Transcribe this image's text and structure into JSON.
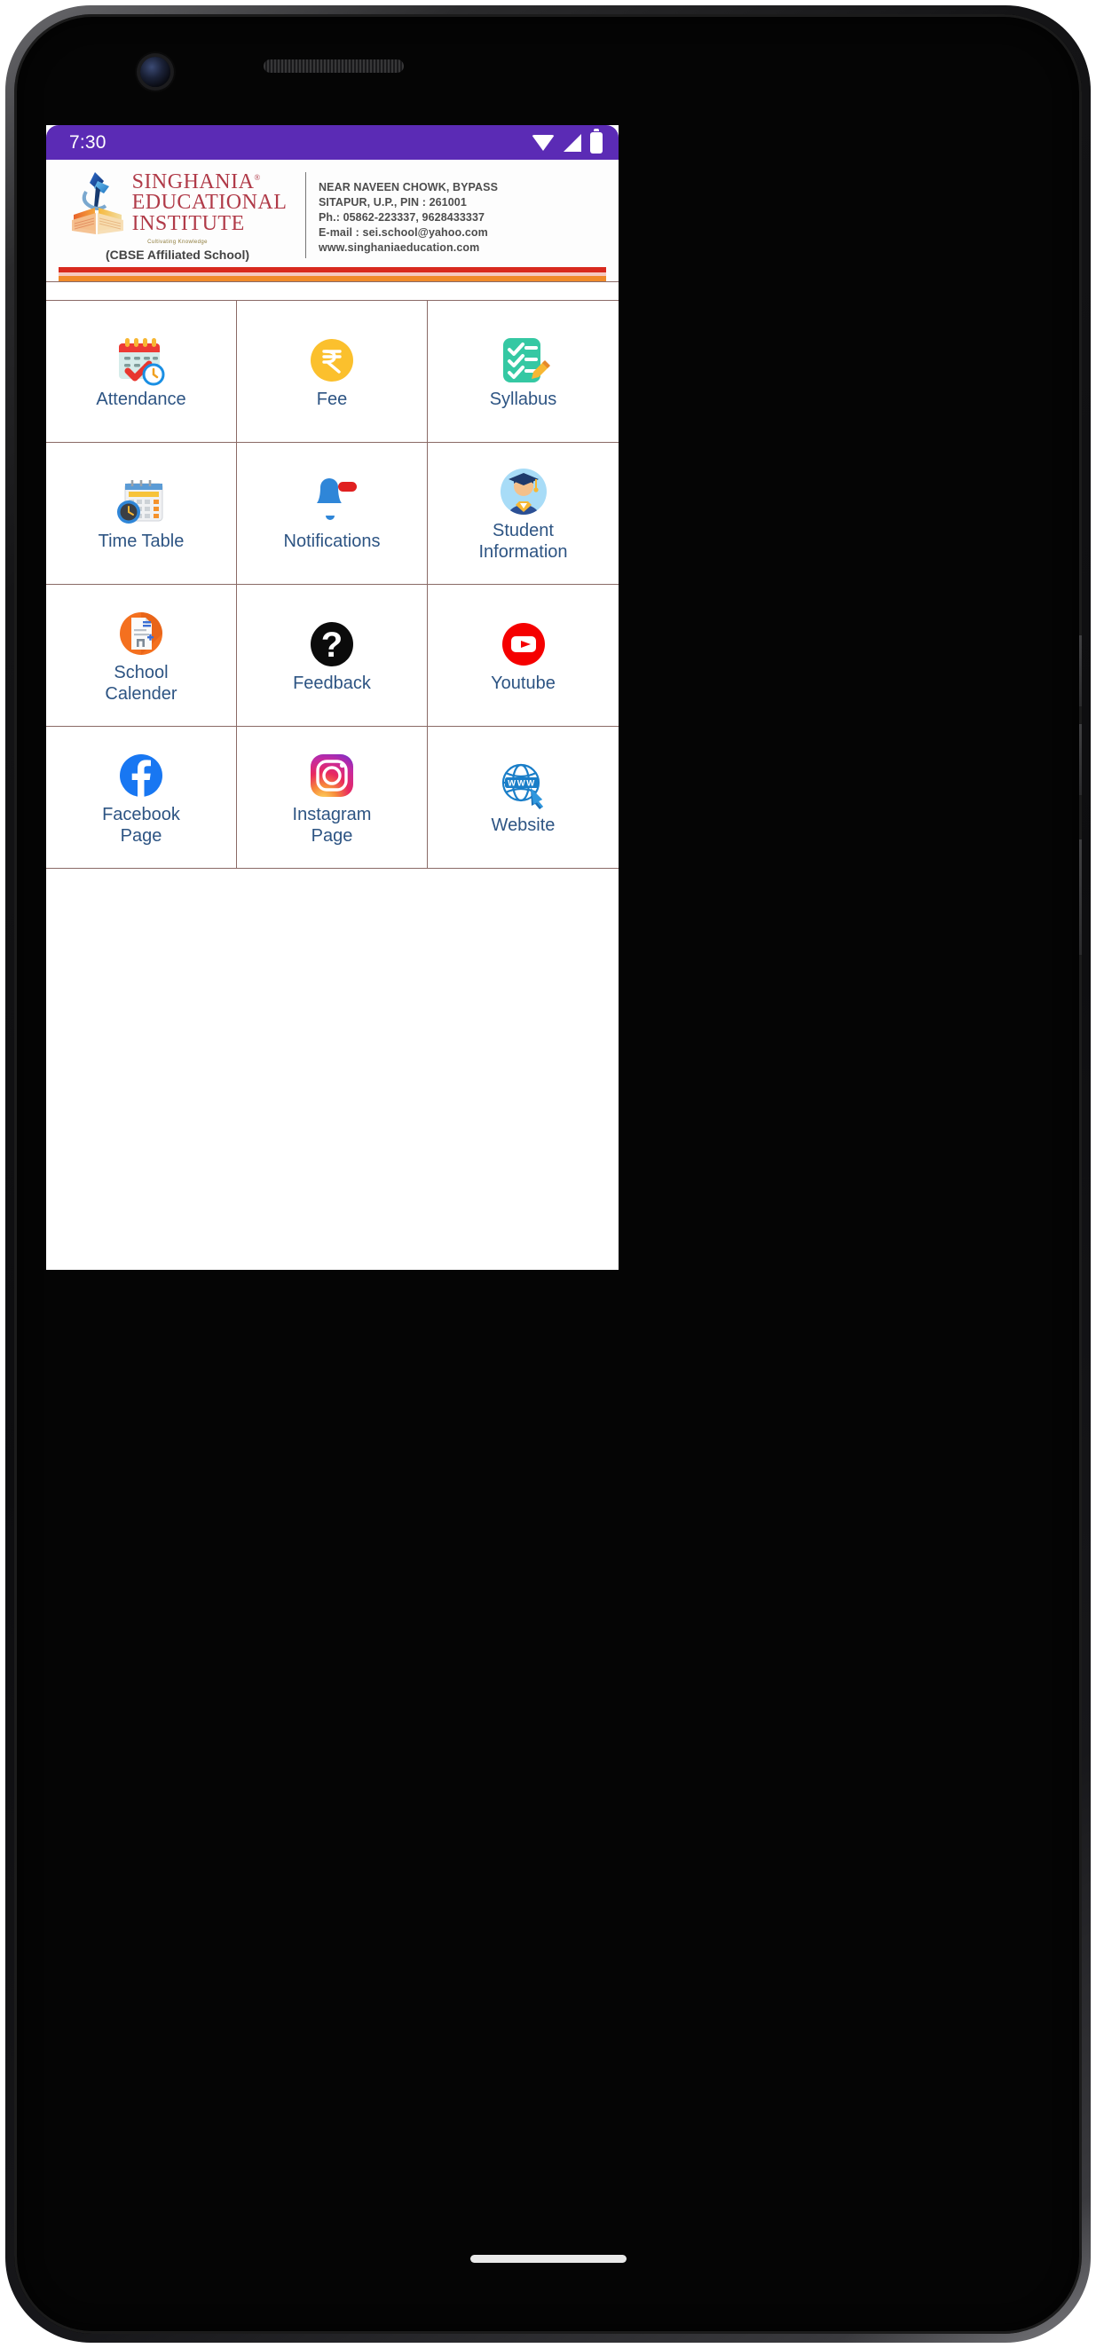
{
  "status_bar": {
    "clock": "7:30",
    "icons": [
      "wifi-icon",
      "cellular-signal-icon",
      "battery-icon"
    ],
    "background_color": "#5B2BB5"
  },
  "letterhead": {
    "logo_icon": "singhania-book-torch-logo",
    "name_line1": "SINGHANIA",
    "name_line1_sup": "®",
    "name_line2": "EDUCATIONAL",
    "name_line3": "INSTITUTE",
    "tagline": "Cultivating Knowledge",
    "affiliation": "(CBSE Affiliated School)",
    "brand_color": "#B03A48",
    "address": [
      "NEAR NAVEEN CHOWK, BYPASS",
      "SITAPUR, U.P., PIN : 261001",
      "Ph.: 05862-223337, 9628433337",
      "E-mail : sei.school@yahoo.com",
      "www.singhaniaeducation.com"
    ],
    "rule_colors": [
      "#D82A1E",
      "#F6C9C0",
      "#F08A2A"
    ]
  },
  "grid": {
    "label_color": "#2D5483",
    "border_color": "#8A6A66",
    "items": [
      {
        "id": "attendance",
        "label": "Attendance",
        "icon": "calendar-check-clock-icon"
      },
      {
        "id": "fee",
        "label": "Fee",
        "icon": "rupee-coin-icon"
      },
      {
        "id": "syllabus",
        "label": "Syllabus",
        "icon": "checklist-pencil-icon"
      },
      {
        "id": "time-table",
        "label": "Time Table",
        "icon": "calendar-clock-icon"
      },
      {
        "id": "notifications",
        "label": "Notifications",
        "icon": "bell-badge-icon"
      },
      {
        "id": "student-information",
        "label": "Student\nInformation",
        "icon": "graduate-avatar-icon"
      },
      {
        "id": "school-calender",
        "label": "School\nCalender",
        "icon": "orange-document-icon"
      },
      {
        "id": "feedback",
        "label": "Feedback",
        "icon": "question-mark-icon"
      },
      {
        "id": "youtube",
        "label": "Youtube",
        "icon": "youtube-icon"
      },
      {
        "id": "facebook-page",
        "label": "Facebook\nPage",
        "icon": "facebook-icon"
      },
      {
        "id": "instagram-page",
        "label": "Instagram\nPage",
        "icon": "instagram-icon"
      },
      {
        "id": "website",
        "label": "Website",
        "icon": "www-globe-click-icon"
      }
    ]
  },
  "navigation": {
    "home_indicator": "home-indicator-pill"
  }
}
